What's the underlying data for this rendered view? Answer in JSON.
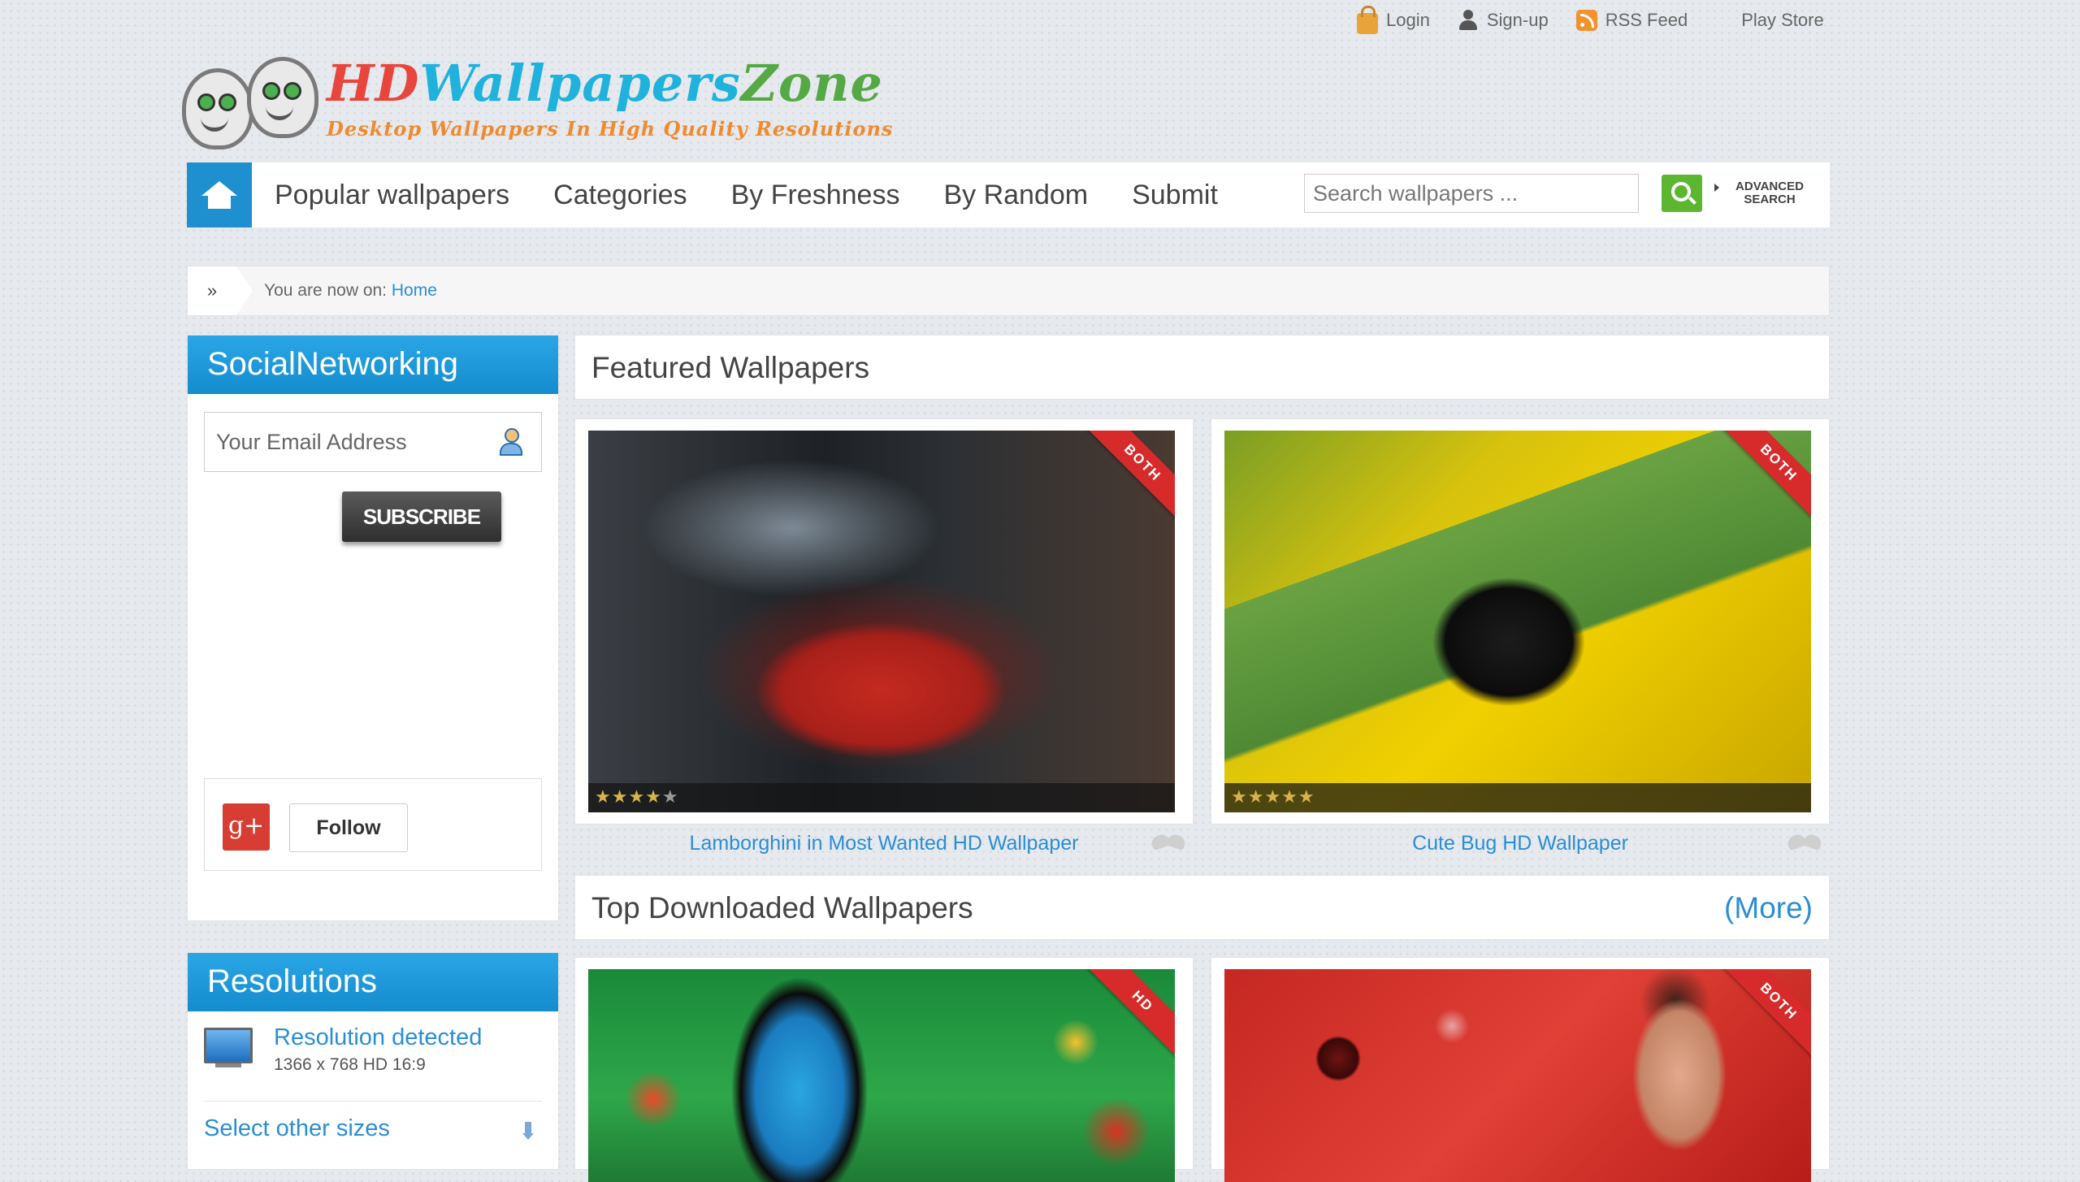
{
  "top_links": {
    "login": "Login",
    "signup": "Sign-up",
    "rss": "RSS Feed",
    "play_store": "Play Store"
  },
  "logo": {
    "title_part1": "HD",
    "title_part2": "Wallpapers",
    "title_part3": "Zone",
    "tagline": "Desktop Wallpapers In High Quality Resolutions"
  },
  "nav": {
    "items": [
      "Popular wallpapers",
      "Categories",
      "By Freshness",
      "By Random",
      "Submit"
    ],
    "search_placeholder": "Search wallpapers ...",
    "advanced_line1": "ADVANCED",
    "advanced_line2": "SEARCH"
  },
  "breadcrumb": {
    "arrow": "»",
    "prefix": "You are now on:",
    "current": "Home"
  },
  "social": {
    "title": "SocialNetworking",
    "email_placeholder": "Your Email Address",
    "subscribe": "SUBSCRIBE",
    "gplus": "g+",
    "follow": "Follow"
  },
  "resolutions": {
    "title": "Resolutions",
    "detected_label": "Resolution detected",
    "detected_value": "1366 x 768 HD 16:9",
    "select_other": "Select other sizes"
  },
  "featured": {
    "title": "Featured Wallpapers",
    "items": [
      {
        "caption": "Lamborghini in Most Wanted HD Wallpaper",
        "badge": "BOTH",
        "rating": 4
      },
      {
        "caption": "Cute Bug HD Wallpaper",
        "badge": "BOTH",
        "rating": 5
      }
    ]
  },
  "top_downloaded": {
    "title": "Top Downloaded Wallpapers",
    "more": "(More)",
    "items": [
      {
        "badge": "HD"
      },
      {
        "badge": "BOTH"
      }
    ]
  },
  "colors": {
    "accent_blue": "#1e90d0",
    "link_blue": "#2a8ed3",
    "search_green": "#5cb630",
    "badge_red": "#d72a2a"
  }
}
